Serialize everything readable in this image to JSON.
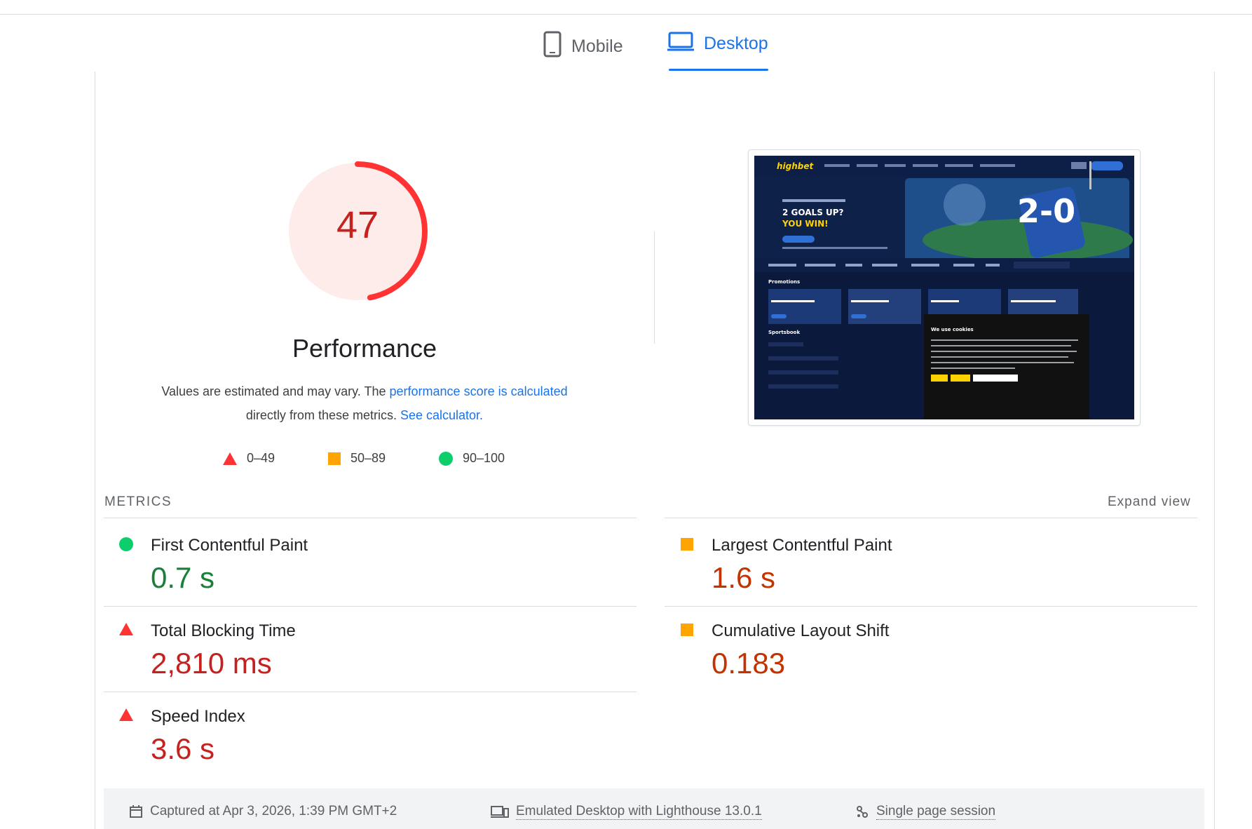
{
  "tabs": {
    "mobile": "Mobile",
    "desktop": "Desktop",
    "active": "Desktop"
  },
  "score": {
    "value": "47",
    "fraction": 0.47,
    "color": "#ff3333",
    "bg": "#fdecea"
  },
  "performance": {
    "title": "Performance",
    "desc_prefix": "Values are estimated and may vary. The ",
    "desc_link1": "performance score is calculated",
    "desc_mid": " directly from these metrics. ",
    "desc_link2": "See calculator.",
    "desc_suffix": ""
  },
  "legend": [
    {
      "range": "0–49",
      "shape": "triangle",
      "color": "#ff3333"
    },
    {
      "range": "50–89",
      "shape": "square",
      "color": "#ffa400"
    },
    {
      "range": "90–100",
      "shape": "circle",
      "color": "#0cce6b"
    }
  ],
  "metrics_header": {
    "label": "METRICS",
    "expand": "Expand view"
  },
  "metrics": [
    {
      "name": "First Contentful Paint",
      "value": "0.7 s",
      "status": "circle",
      "color": "#0cce6b",
      "value_color": "#188038"
    },
    {
      "name": "Largest Contentful Paint",
      "value": "1.6 s",
      "status": "square",
      "color": "#ffa400",
      "value_color": "#c33300"
    },
    {
      "name": "Total Blocking Time",
      "value": "2,810 ms",
      "status": "triangle",
      "color": "#ff3333",
      "value_color": "#c5221f"
    },
    {
      "name": "Cumulative Layout Shift",
      "value": "0.183",
      "status": "square",
      "color": "#ffa400",
      "value_color": "#c33300"
    },
    {
      "name": "Speed Index",
      "value": "3.6 s",
      "status": "triangle",
      "color": "#ff3333",
      "value_color": "#c5221f"
    }
  ],
  "footer": {
    "captured": "Captured at Apr 3, 2026, 1:39 PM GMT+2",
    "emulated": "Emulated Desktop with Lighthouse 13.0.1",
    "session": "Single page session"
  },
  "screenshot": {
    "brand": "highbet",
    "headline1": "2 GOALS UP?",
    "headline2": "YOU WIN!",
    "big": "2-0",
    "promotions": "Promotions",
    "sportsbook": "Sportsbook",
    "cookie_title": "We use cookies"
  }
}
